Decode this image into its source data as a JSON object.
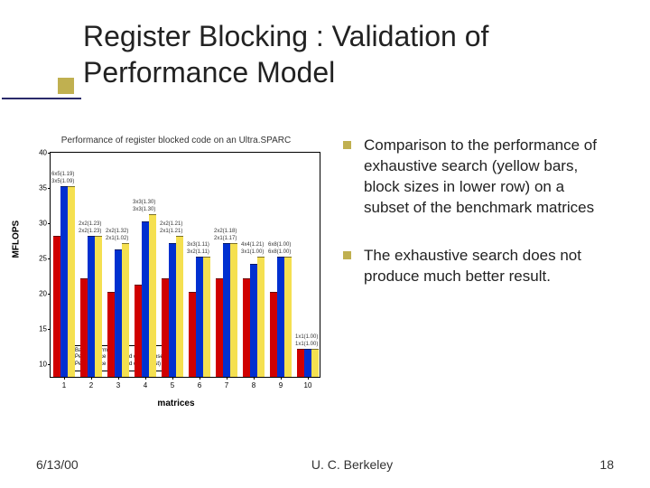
{
  "title": "Register Blocking : Validation of Performance Model",
  "bullets": [
    "Comparison to the performance of exhaustive search (yellow bars, block sizes in lower row) on a subset of the benchmark matrices",
    "The exhaustive search does not produce much better result."
  ],
  "footer": {
    "left": "6/13/00",
    "center": "U. C. Berkeley",
    "right": "18"
  },
  "chart_data": {
    "type": "bar",
    "title": "Performance of register blocked code on an Ultra.SPARC",
    "xlabel": "matrices",
    "ylabel": "MFLOPS",
    "ylim": [
      8,
      40
    ],
    "yticks": [
      10,
      15,
      20,
      25,
      30,
      35,
      40
    ],
    "categories": [
      "1",
      "2",
      "3",
      "4",
      "5",
      "6",
      "7",
      "8",
      "9",
      "10"
    ],
    "series": [
      {
        "name": "Base performance",
        "color": "red",
        "values": [
          28,
          22,
          20,
          21,
          22,
          20,
          22,
          22,
          20,
          12
        ]
      },
      {
        "name": "Performance of blocked code (chosen size)",
        "color": "blue",
        "values": [
          35,
          28,
          26,
          30,
          27,
          25,
          27,
          24,
          25,
          12
        ]
      },
      {
        "name": "Performance of blocked code (best)",
        "color": "yellow",
        "values": [
          35,
          28,
          27,
          31,
          28,
          25,
          27,
          25,
          25,
          12
        ]
      }
    ],
    "annotations": {
      "1": [
        "6x5(1.19)",
        "3x5(1.09)"
      ],
      "2": [
        "2x2(1.23)",
        "2x2(1.23)"
      ],
      "3": [
        "2x2(1.32)",
        "2x1(1.02)"
      ],
      "4": [
        "3x3(1.30)",
        "3x3(1.30)"
      ],
      "5": [
        "2x2(1.21)",
        "2x1(1.21)"
      ],
      "6": [
        "3x3(1.11)",
        "3x2(1.11)"
      ],
      "7": [
        "2x2(1.18)",
        "2x1(1.17)"
      ],
      "8": [
        "4x4(1.21)",
        "3x1(1.00)"
      ],
      "9": [
        "6x8(1.00)",
        "6x8(1.00)"
      ],
      "10": [
        "1x1(1.00)",
        "1x1(1.00)"
      ]
    },
    "legend": [
      {
        "swatch": "#d00000",
        "label": "Base performance"
      },
      {
        "swatch": "#0030d0",
        "label": "Performance of blocked code (chosen size)"
      },
      {
        "swatch": "#f5e050",
        "label": "Performance of blocked code (best)"
      }
    ]
  }
}
